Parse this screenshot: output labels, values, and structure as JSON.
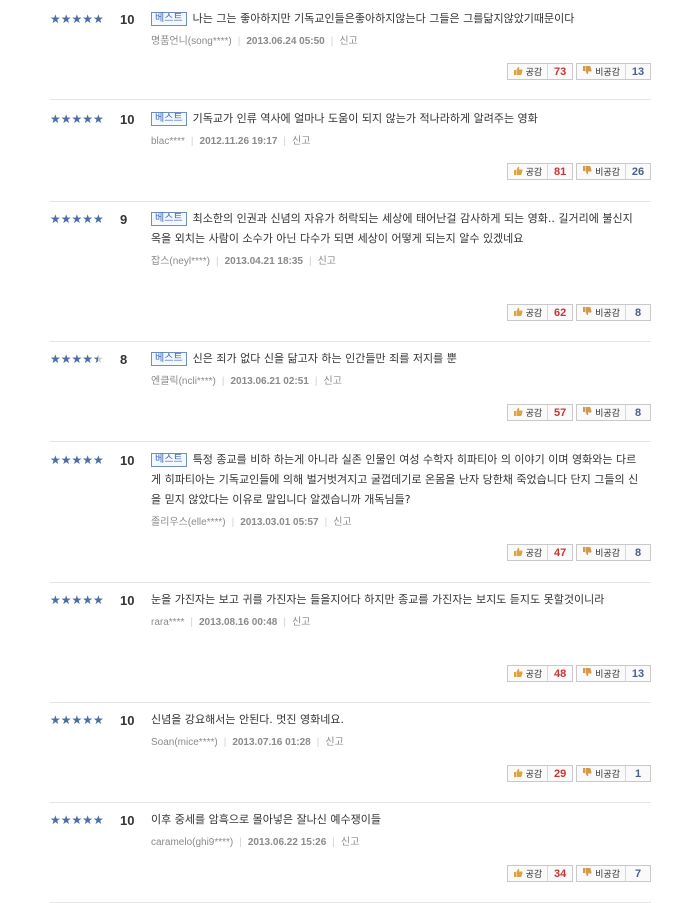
{
  "best_label": "베스트",
  "report_label": "신고",
  "like_label": "공감",
  "dislike_label": "비공감",
  "star_color": "#4a6ea9",
  "reviews": [
    {
      "rating": "10",
      "stars_fill": 1.0,
      "best": true,
      "text": "나는 그는 좋아하지만 기독교인들은좋아하지않는다 그들은 그를닮지않았기때문이다",
      "author": "명품언니(song****)",
      "date": "2013.06.24 05:50",
      "likes": "73",
      "dislikes": "13"
    },
    {
      "rating": "10",
      "stars_fill": 1.0,
      "best": true,
      "text": "기독교가 인류 역사에 얼마나 도움이 되지 않는가 적나라하게 알려주는 영화",
      "author": "blac****",
      "date": "2012.11.26 19:17",
      "likes": "81",
      "dislikes": "26"
    },
    {
      "rating": "9",
      "stars_fill": 0.9,
      "best": true,
      "text": "최소한의 인권과 신념의 자유가 허락되는 세상에 태어난걸 감사하게 되는 영화.. 길거리에 불신지옥을 외치는 사람이 소수가 아닌 다수가 되면 세상이 어떻게 되는지 알수 있겠네요",
      "author": "잡스(neyl****)",
      "date": "2013.04.21 18:35",
      "likes": "62",
      "dislikes": "8"
    },
    {
      "rating": "8",
      "stars_fill": 0.8,
      "best": true,
      "text": "신은 죄가 없다 신을 닮고자 하는 인간들만 죄를 저지를 뿐",
      "author": "엔클릭(ncli****)",
      "date": "2013.06.21 02:51",
      "likes": "57",
      "dislikes": "8"
    },
    {
      "rating": "10",
      "stars_fill": 1.0,
      "best": true,
      "text": "특정 종교를 비하 하는게 아니라 실존 인물인 여성 수학자 히파티아 의 이야기 이며 영화와는 다르게 히파티아는 기독교인들에 의해 벌거벗겨지고 굴껍데기로 온몸을 난자 당한채 죽었습니다 단지 그들의 신을 믿지 않았다는 이유로 말입니다 알겠습니까 개독님들?",
      "author": "졸리우스(elle****)",
      "date": "2013.03.01 05:57",
      "likes": "47",
      "dislikes": "8"
    },
    {
      "rating": "10",
      "stars_fill": 1.0,
      "best": false,
      "text": "눈을 가진자는 보고 귀를 가진자는 들을지어다 하지만 종교를 가진자는 보지도 듣지도 못할것이니라",
      "author": "rara****",
      "date": "2013.08.16 00:48",
      "likes": "48",
      "dislikes": "13"
    },
    {
      "rating": "10",
      "stars_fill": 1.0,
      "best": false,
      "text": "신념을 강요해서는 안된다. 멋진 영화네요.",
      "author": "Soan(mice****)",
      "date": "2013.07.16 01:28",
      "likes": "29",
      "dislikes": "1"
    },
    {
      "rating": "10",
      "stars_fill": 1.0,
      "best": false,
      "text": "이후 중세를 암흑으로 몰아넣은 잘나신 예수쟁이들",
      "author": "caramelo(ghi9****)",
      "date": "2013.06.22 15:26",
      "likes": "34",
      "dislikes": "7"
    }
  ]
}
